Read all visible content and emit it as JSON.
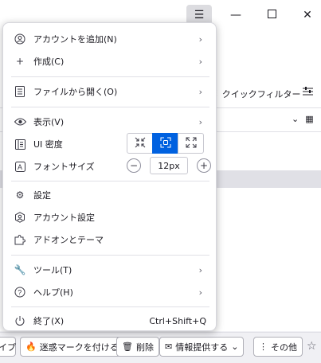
{
  "window": {
    "menu_icon": "hamburger-icon",
    "minimize_icon": "minimize-icon",
    "maximize_icon": "maximize-icon",
    "close_icon": "close-icon"
  },
  "toolbar": {
    "quick_filter": "クイックフィルター"
  },
  "bottom_bar": {
    "type_partial": "イプ",
    "junk": "迷惑マークを付ける",
    "delete": "削除",
    "report": "情報提供する",
    "more": "その他"
  },
  "menu": {
    "add_account": "アカウントを追加(N)",
    "create": "作成(C)",
    "open_file": "ファイルから開く(O)",
    "view": "表示(V)",
    "ui_density": "UI 密度",
    "font_size": "フォントサイズ",
    "font_size_value": "12px",
    "settings": "設定",
    "account_settings": "アカウント設定",
    "addons_themes": "アドオンとテーマ",
    "tools": "ツール(T)",
    "help": "ヘルプ(H)",
    "quit": "終了(X)",
    "quit_shortcut": "Ctrl+Shift+Q",
    "density_selected": "normal"
  },
  "colors": {
    "accent": "#0061e0",
    "panel_bg": "#ffffff",
    "app_bg": "#f0f0f4"
  }
}
